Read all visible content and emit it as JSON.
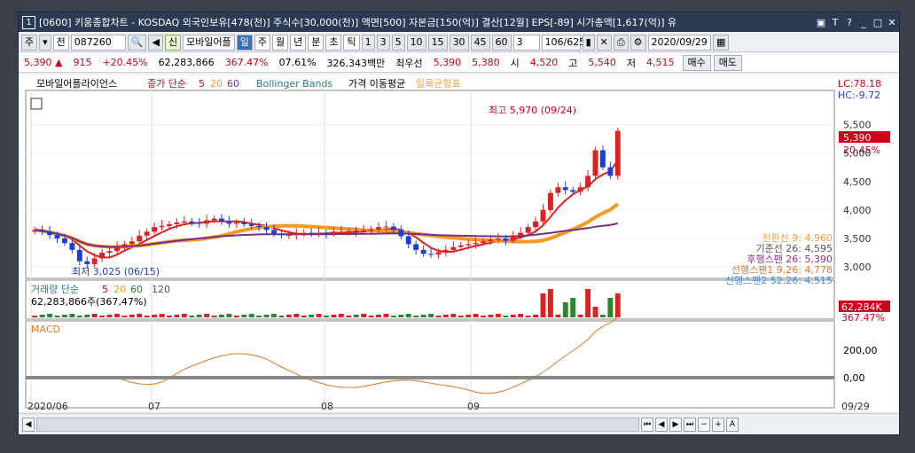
{
  "title": {
    "window_num": "1",
    "text": "[0600] 키움종합차트 - KOSDAQ 외국인보유[478(천)] 주식수[30,000(천)] 액면[500] 자본금[150(억)] 결산[12월] EPS[-89] 시가총액[1,617(억)] 유"
  },
  "toolbar": {
    "market": "주",
    "prev": "전",
    "code": "087260",
    "new_label": "신",
    "company": "모바일어플",
    "periods": [
      "일",
      "주",
      "월",
      "년",
      "분",
      "초",
      "틱"
    ],
    "selected_period": "일",
    "intervals": [
      "1",
      "3",
      "5",
      "10",
      "15",
      "30",
      "45",
      "60"
    ],
    "interval_value": "3",
    "page_count": "106/625",
    "date": "2020/09/29"
  },
  "quote": {
    "price": "5,390",
    "change_arrow": "▲",
    "change": "915",
    "change_pct": "+20.45%",
    "volume": "62,283,866",
    "volume_ratio": "367.47%",
    "turnover": "07.61%",
    "amount": "326,343백만",
    "best_label": "최우선",
    "ask": "5,390",
    "bid": "5,380",
    "open_label": "시",
    "open": "4,520",
    "high_label": "고",
    "high": "5,540",
    "low_label": "저",
    "low": "4,515",
    "buy_label": "매수",
    "sell_label": "매도"
  },
  "legend": {
    "name": "모바일어플라이언스",
    "ma_title": "종가 단순",
    "ma_periods": [
      "5",
      "20",
      "60"
    ],
    "bb": "Bollinger Bands",
    "ichimoku_label": "가격 이동평균",
    "ichimoku2": "일목균형표"
  },
  "right_labels": {
    "lc": "LC:78.18",
    "hc": "HC:-9.72",
    "price_tag": "5,390",
    "pct_tag": "20.45%",
    "vol_tag": "62,284K",
    "vol_pct_tag": "367.47%"
  },
  "annotations": {
    "max": "최고 5,970 (09/24)",
    "min": "최저 3,025 (06/15)"
  },
  "ichimoku_labels": [
    {
      "text": "전환선 9: 4,960",
      "color": "#f2a040"
    },
    {
      "text": "기준선 26: 4,595",
      "color": "#555555"
    },
    {
      "text": "후행스팬 26: 5,390",
      "color": "#8a2f8a"
    },
    {
      "text": "선행스팬1 9,26: 4,778",
      "color": "#e0772f"
    },
    {
      "text": "선행스팬2 52,26: 4,515",
      "color": "#4a90d9"
    }
  ],
  "volume_panel": {
    "title": "거래량 단순",
    "periods": [
      "5",
      "20",
      "60",
      "120"
    ],
    "value": "62,283,866주(367,47%)"
  },
  "macd_panel": {
    "title": "MACD",
    "ticks": [
      "200,00",
      "0,00"
    ]
  },
  "x_labels": [
    "2020/06",
    "07",
    "08",
    "09",
    "09/29"
  ],
  "chart_data": {
    "type": "candlestick",
    "y_ticks": [
      5500,
      5000,
      4500,
      4000,
      3500,
      3000
    ],
    "ylim": [
      2800,
      6100
    ],
    "closes": [
      3650,
      3620,
      3560,
      3500,
      3420,
      3300,
      3100,
      3050,
      3150,
      3250,
      3280,
      3350,
      3400,
      3450,
      3550,
      3620,
      3700,
      3720,
      3750,
      3780,
      3800,
      3780,
      3760,
      3820,
      3850,
      3800,
      3760,
      3780,
      3750,
      3720,
      3700,
      3650,
      3580,
      3560,
      3560,
      3580,
      3600,
      3590,
      3600,
      3580,
      3620,
      3620,
      3630,
      3610,
      3640,
      3660,
      3700,
      3710,
      3650,
      3540,
      3400,
      3300,
      3230,
      3220,
      3260,
      3300,
      3350,
      3380,
      3400,
      3420,
      3450,
      3480,
      3500,
      3460,
      3550,
      3600,
      3700,
      3800,
      4000,
      4300,
      4400,
      4350,
      4320,
      4400,
      4600,
      5050,
      4750,
      4600,
      5390
    ],
    "colors": {
      "up": "#e02020",
      "down": "#1c3fd1",
      "ma5": "#e02020",
      "ma20": "#f59a1e",
      "ma60": "#7a2d84"
    }
  }
}
